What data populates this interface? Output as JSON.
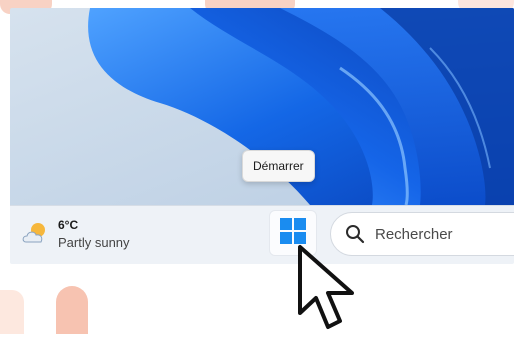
{
  "tooltip": {
    "label": "Démarrer"
  },
  "taskbar": {
    "weather": {
      "temperature": "6°C",
      "condition": "Partly sunny",
      "icon": "partly-sunny-icon"
    },
    "start_button": {
      "icon": "windows-logo-icon"
    },
    "search": {
      "label": "Rechercher",
      "icon": "search-icon"
    }
  },
  "colors": {
    "wallpaper_background": "#c8d6e6",
    "wallpaper_blue": "#0a5ad6",
    "taskbar_background": "#eef2f7",
    "windows_logo": "#1a8cf0"
  }
}
